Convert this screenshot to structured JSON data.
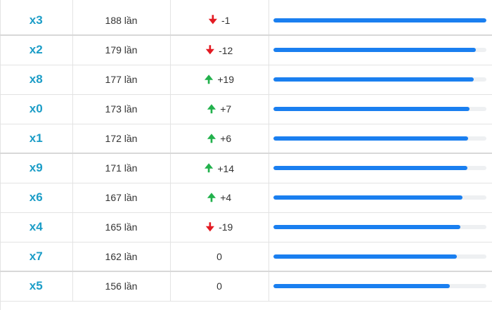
{
  "rows": [
    {
      "number": "x3",
      "count": "188 lần",
      "direction": "down",
      "change": "-1",
      "percent": 100
    },
    {
      "number": "x2",
      "count": "179 lần",
      "direction": "down",
      "change": "-12",
      "percent": 95.2
    },
    {
      "number": "x8",
      "count": "177 lần",
      "direction": "up",
      "change": "+19",
      "percent": 94.1
    },
    {
      "number": "x0",
      "count": "173 lần",
      "direction": "up",
      "change": "+7",
      "percent": 92.0
    },
    {
      "number": "x1",
      "count": "172 lần",
      "direction": "up",
      "change": "+6",
      "percent": 91.5
    },
    {
      "number": "x9",
      "count": "171 lần",
      "direction": "up",
      "change": "+14",
      "percent": 91.0
    },
    {
      "number": "x6",
      "count": "167 lần",
      "direction": "up",
      "change": "+4",
      "percent": 88.8
    },
    {
      "number": "x4",
      "count": "165 lần",
      "direction": "down",
      "change": "-19",
      "percent": 87.8
    },
    {
      "number": "x7",
      "count": "162 lần",
      "direction": "none",
      "change": "0",
      "percent": 86.2
    },
    {
      "number": "x5",
      "count": "156 lần",
      "direction": "none",
      "change": "0",
      "percent": 83.0
    }
  ],
  "colors": {
    "number_text": "#1c9dc7",
    "bar_fill": "#1a7ff0",
    "bar_track": "#eef0f2",
    "arrow_up": "#22b14c",
    "arrow_down": "#e31b23"
  },
  "icons": {
    "up": "arrow-up-icon",
    "down": "arrow-down-icon"
  }
}
